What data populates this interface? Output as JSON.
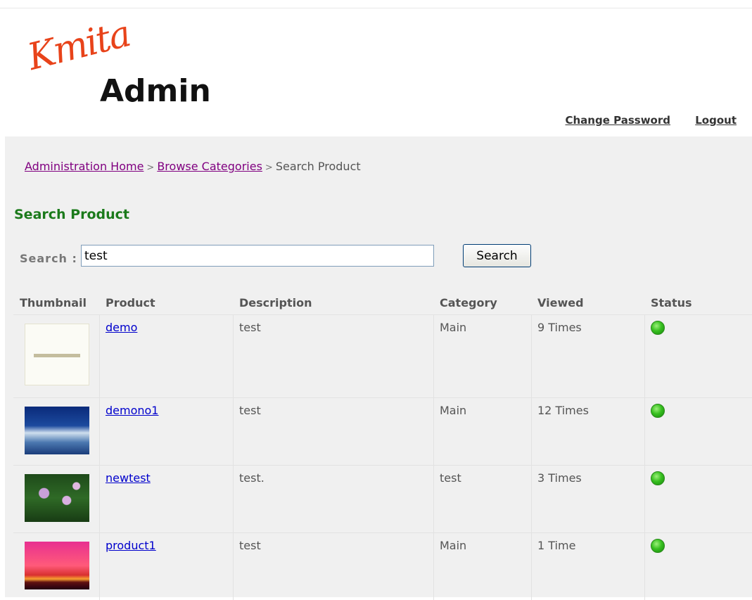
{
  "logo": {
    "script": "Kmita",
    "bold": "Admin"
  },
  "header_links": {
    "change_password": "Change Password",
    "logout": "Logout"
  },
  "breadcrumb": {
    "home": "Administration Home",
    "categories": "Browse Categories",
    "current": "Search Product",
    "separator": ">"
  },
  "page_title": "Search Product",
  "search": {
    "label": "Search :",
    "value": "test",
    "button": "Search"
  },
  "table": {
    "headers": [
      "Thumbnail",
      "Product",
      "Description",
      "Category",
      "Viewed",
      "Status"
    ],
    "rows": [
      {
        "product": "demo",
        "description": "test",
        "category": "Main",
        "viewed": "9 Times",
        "status_icon": "green-status-icon"
      },
      {
        "product": "demono1",
        "description": "test",
        "category": "Main",
        "viewed": "12 Times",
        "status_icon": "green-status-icon"
      },
      {
        "product": "newtest",
        "description": "test.",
        "category": "test",
        "viewed": "3 Times",
        "status_icon": "green-status-icon"
      },
      {
        "product": "product1",
        "description": "test",
        "category": "Main",
        "viewed": "1 Time",
        "status_icon": "green-status-icon"
      }
    ]
  },
  "colors": {
    "title_green": "#1b7a1b",
    "logo_orange": "#e8431a",
    "visited_link": "#800080",
    "link": "#0000cc"
  }
}
